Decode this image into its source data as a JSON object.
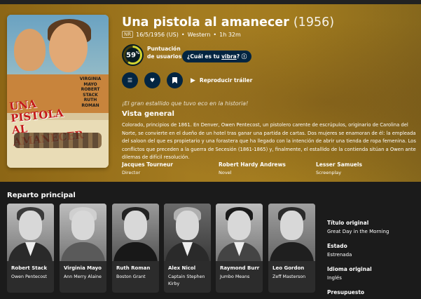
{
  "movie": {
    "title": "Una pistola al amanecer",
    "year": "(1956)",
    "certification": "NR",
    "release": "16/5/1956 (US)",
    "genre": "Western",
    "runtime": "1h 32m",
    "score": "59",
    "score_unit": "%",
    "score_fraction": 0.59,
    "score_label": "Puntuación de usuarios",
    "vibe_prefix": "¿Cuál es tu ",
    "vibe_link": "vibra",
    "vibe_suffix": "?",
    "trailer_label": "Reproducir tráiler",
    "tagline": "¡El gran estallido que tuvo eco en la historia!",
    "overview_heading": "Vista general",
    "overview": "Colorado, principios de 1861. En Denver, Owen Pentecost, un pistolero carente de escrúpulos, originario de Carolina del Norte, se convierte en el dueño de un hotel tras ganar una partida de cartas. Dos mujeres se enamoran de él: la empleada del saloon del que es propietario y una forastera que ha llegado con la intención de abrir una tienda de ropa femenina. Los conflictos que preceden a la guerra de Secesión (1861-1865) y, finalmente, el estallido de la contienda sitúan a Owen ante dilemas de difícil resolución.",
    "crew": [
      {
        "name": "Jacques Tourneur",
        "role": "Director"
      },
      {
        "name": "Robert Hardy Andrews",
        "role": "Novel"
      },
      {
        "name": "Lesser Samuels",
        "role": "Screenplay"
      }
    ]
  },
  "poster": {
    "title_line1": "UNA",
    "title_line2": "PISTOLA",
    "title_line3": "AL AMANECER",
    "cast_names": "VIRGINIA MAYO ROBERT STACK RUTH ROMAN"
  },
  "icons": {
    "list": "list-icon",
    "favorite": "heart-icon",
    "watchlist": "bookmark-icon",
    "play": "play-icon",
    "info": "info-icon"
  },
  "cast": {
    "heading": "Reparto principal",
    "members": [
      {
        "name": "Robert Stack",
        "character": "Owen Pentecost"
      },
      {
        "name": "Virginia Mayo",
        "character": "Ann Merry Alaine"
      },
      {
        "name": "Ruth Roman",
        "character": "Boston Grant"
      },
      {
        "name": "Alex Nicol",
        "character": "Captain Stephen Kirby"
      },
      {
        "name": "Raymond Burr",
        "character": "Jumbo Means"
      },
      {
        "name": "Leo Gordon",
        "character": "Zeff Masterson"
      }
    ]
  },
  "facts": [
    {
      "label": "Título original",
      "value": "Great Day in the Morning"
    },
    {
      "label": "Estado",
      "value": "Estrenada"
    },
    {
      "label": "Idioma original",
      "value": "Inglés"
    },
    {
      "label": "Presupuesto",
      "value": ""
    }
  ],
  "colors": {
    "accent_dark": "#032541",
    "score_ring": "#d2d531",
    "hero_bg": "#a57a1c"
  }
}
